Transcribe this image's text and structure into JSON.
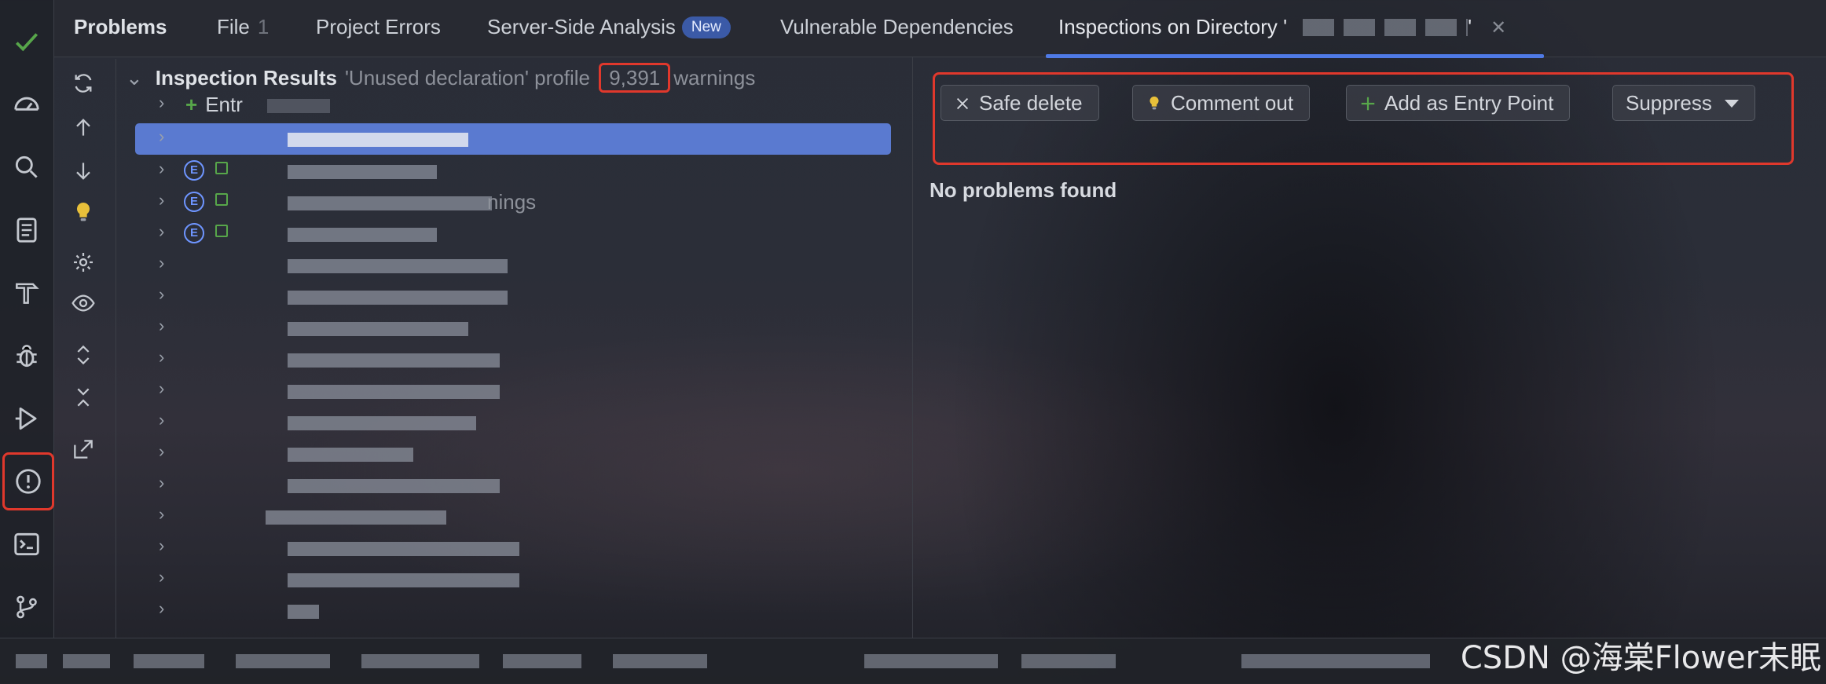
{
  "colors": {
    "accent": "#4f7ae6",
    "highlight_box": "#e0382c",
    "selection": "#5a7ad0",
    "badge": "#3b5aa7"
  },
  "tabs": {
    "problems": "Problems",
    "file": "File",
    "file_count": "1",
    "project_errors": "Project Errors",
    "server_side": "Server-Side Analysis",
    "new_badge": "New",
    "vulnerable": "Vulnerable Dependencies",
    "inspections": "Inspections on Directory '",
    "inspections_suffix": "'"
  },
  "tree": {
    "title": "Inspection Results",
    "profile": "'Unused declaration' profile",
    "count": "9,391",
    "warnings_label": "warnings",
    "first_item": "Entr",
    "partial_text_1": "nings"
  },
  "actions": {
    "safe_delete": "Safe delete",
    "comment_out": "Comment out",
    "add_entry_point": "Add as Entry Point",
    "suppress": "Suppress"
  },
  "detail": {
    "message": "No problems found"
  },
  "watermark": "CSDN @海棠Flower未眠",
  "icons": {
    "activity": [
      "check-icon",
      "dashboard-icon",
      "search-icon",
      "document-icon",
      "hammer-icon",
      "bug-icon",
      "run-icon",
      "problems-icon",
      "terminal-icon",
      "git-branch-icon"
    ],
    "toolbar": [
      "refresh-icon",
      "arrow-up-icon",
      "arrow-down-icon",
      "bulb-icon",
      "gear-icon",
      "eye-icon",
      "expand-icon",
      "collapse-icon",
      "export-icon"
    ]
  }
}
